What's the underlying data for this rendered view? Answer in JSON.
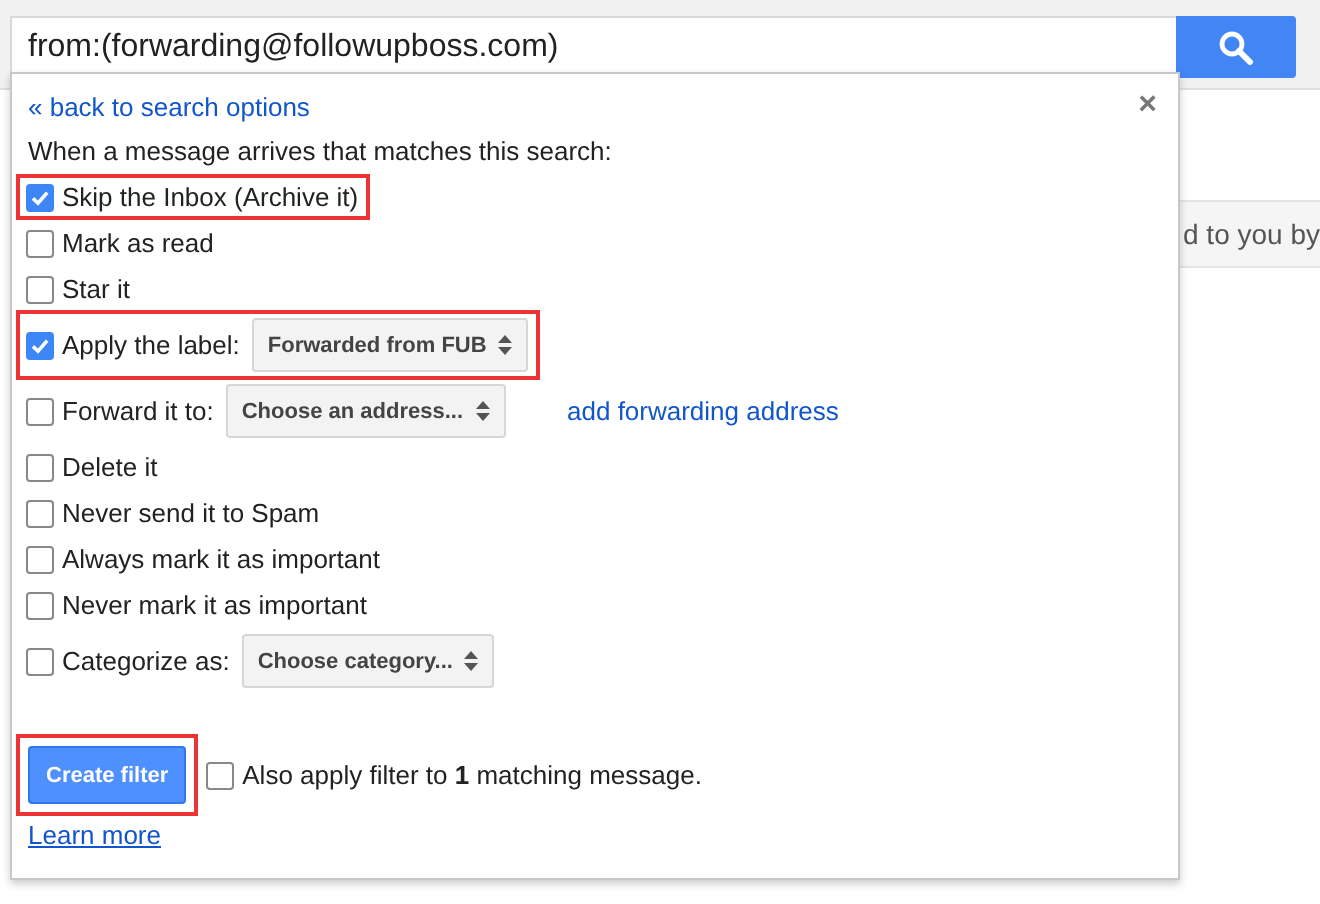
{
  "search": {
    "value": "from:(forwarding@followupboss.com)"
  },
  "background_row": {
    "text": "d to you by"
  },
  "panel": {
    "back_link": "« back to search options",
    "close": "×",
    "intro": "When a message arrives that matches this search:",
    "options": [
      {
        "kind": "checkbox",
        "label": "Skip the Inbox (Archive it)",
        "checked": true,
        "highlighted": true
      },
      {
        "kind": "checkbox",
        "label": "Mark as read",
        "checked": false,
        "highlighted": false
      },
      {
        "kind": "checkbox",
        "label": "Star it",
        "checked": false,
        "highlighted": false
      },
      {
        "kind": "select",
        "label": "Apply the label:",
        "checked": true,
        "highlighted": true,
        "select": "Forwarded from FUB"
      },
      {
        "kind": "select",
        "label": "Forward it to:",
        "checked": false,
        "highlighted": false,
        "select": "Choose an address...",
        "link": "add forwarding address"
      },
      {
        "kind": "checkbox",
        "label": "Delete it",
        "checked": false,
        "highlighted": false
      },
      {
        "kind": "checkbox",
        "label": "Never send it to Spam",
        "checked": false,
        "highlighted": false
      },
      {
        "kind": "checkbox",
        "label": "Always mark it as important",
        "checked": false,
        "highlighted": false
      },
      {
        "kind": "checkbox",
        "label": "Never mark it as important",
        "checked": false,
        "highlighted": false
      },
      {
        "kind": "select",
        "label": "Categorize as:",
        "checked": false,
        "highlighted": false,
        "select": "Choose category..."
      }
    ],
    "create_button": {
      "label": "Create filter",
      "highlighted": true
    },
    "also_apply": {
      "text": "Also apply filter to **1** matching message.",
      "checked": false
    },
    "learn_more": "Learn more"
  }
}
